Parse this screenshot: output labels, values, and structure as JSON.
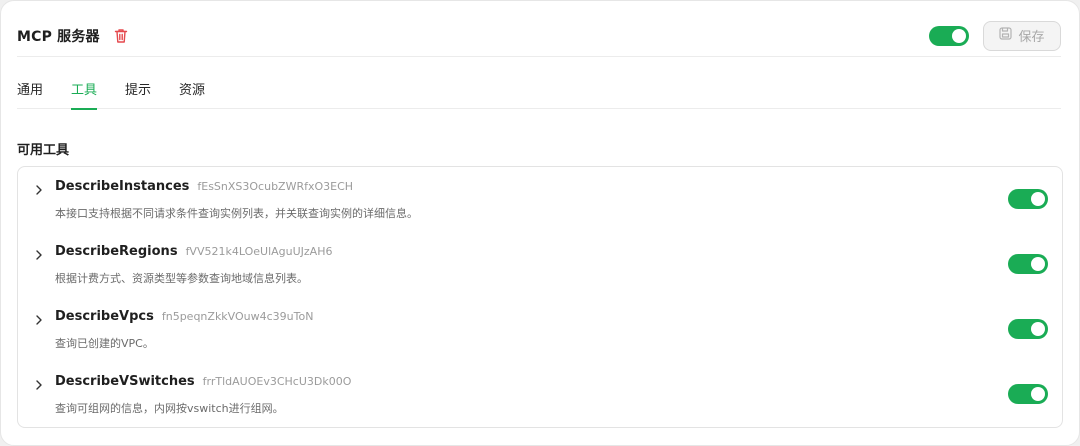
{
  "header": {
    "title": "MCP 服务器",
    "save_label": "保存"
  },
  "tabs": [
    {
      "label": "通用",
      "active": false
    },
    {
      "label": "工具",
      "active": true
    },
    {
      "label": "提示",
      "active": false
    },
    {
      "label": "资源",
      "active": false
    }
  ],
  "section": {
    "title": "可用工具"
  },
  "tools": [
    {
      "name": "DescribeInstances",
      "id": "fEsSnXS3OcubZWRfxO3ECH",
      "description": "本接口支持根据不同请求条件查询实例列表，并关联查询实例的详细信息。",
      "enabled": true
    },
    {
      "name": "DescribeRegions",
      "id": "fVV521k4LOeUlAguUJzAH6",
      "description": "根据计费方式、资源类型等参数查询地域信息列表。",
      "enabled": true
    },
    {
      "name": "DescribeVpcs",
      "id": "fn5peqnZkkVOuw4c39uToN",
      "description": "查询已创建的VPC。",
      "enabled": true
    },
    {
      "name": "DescribeVSwitches",
      "id": "frrTldAUOEv3CHcU3Dk00O",
      "description": "查询可组网的信息，内网按vswitch进行组网。",
      "enabled": true
    }
  ],
  "colors": {
    "accent": "#1aac55",
    "danger": "#e5484d"
  }
}
